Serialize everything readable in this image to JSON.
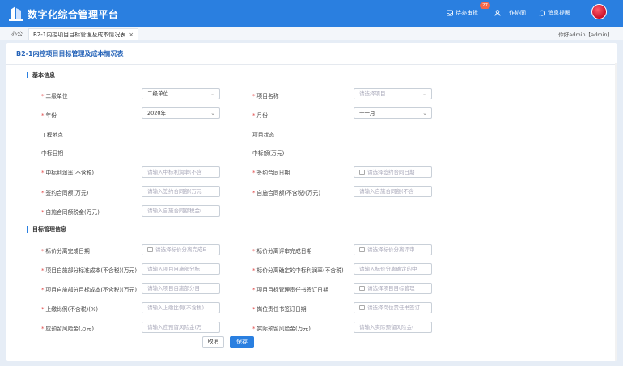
{
  "header": {
    "title": "数字化综合管理平台",
    "nav": [
      {
        "label": "待办审批",
        "icon": "inbox-icon",
        "badge": "27"
      },
      {
        "label": "工作协同",
        "icon": "user-icon"
      },
      {
        "label": "消息提醒",
        "icon": "bell-icon"
      }
    ],
    "accent": "#2a7fe0"
  },
  "tabs": {
    "home": "办公",
    "active": "B2-1内控项目目标管理及成本情况表",
    "close": "×"
  },
  "user": "你好admin【admin】",
  "page": {
    "title": "B2-1内控项目目标管理及成本情况表"
  },
  "sections": {
    "basic": "基本信息",
    "target": "目标管理信息"
  },
  "fields": {
    "unit": {
      "label": "二级单位",
      "value": "二级单位"
    },
    "project": {
      "label": "项目名称",
      "placeholder": "请选择项目"
    },
    "year": {
      "label": "年份",
      "value": "2020年"
    },
    "month": {
      "label": "月份",
      "value": "十一月"
    },
    "location": {
      "label": "工程地点"
    },
    "status": {
      "label": "项目状态"
    },
    "bid_date": {
      "label": "中标日期"
    },
    "bid_amount": {
      "label": "中标额(万元)"
    },
    "bid_profit": {
      "label": "中标利润率(不含税)",
      "placeholder": "请输入中标利润率(不含"
    },
    "sign_date": {
      "label": "签约合同日期",
      "placeholder": "请选择签约合同日期"
    },
    "sign_amount": {
      "label": "签约合同额(万元)",
      "placeholder": "请输入签约合同额(万元"
    },
    "self_amount": {
      "label": "自施合同额(不含税)(万元)",
      "placeholder": "请输入自施合同额(不含"
    },
    "self_tax": {
      "label": "自施合同额税金(万元)",
      "placeholder": "请输入自施合同额税金("
    },
    "split_date": {
      "label": "标价分离完成日期",
      "placeholder": "请选择标价分离完成E"
    },
    "review_date": {
      "label": "标价分离评审完成日期",
      "placeholder": "请选择标价分离评审"
    },
    "self_cost": {
      "label": "项目自施部分标准成本(不含税)(万元)",
      "placeholder": "请输入项目自施部分标"
    },
    "split_profit": {
      "label": "标价分离确定的中标利润率(不含税)",
      "placeholder": "请输入标价分离确定的中"
    },
    "target_cost": {
      "label": "项目自施部分目标成本(不含税)(万元)",
      "placeholder": "请输入项目自施部分目"
    },
    "duty_date": {
      "label": "项目目标管理责任书签订日期",
      "placeholder": "请选择项目目标管理"
    },
    "pay_ratio": {
      "label": "上缴比例(不含税)(%)",
      "placeholder": "请输入上缴比例(不含税)"
    },
    "post_date": {
      "label": "岗位责任书签订日期",
      "placeholder": "请选择岗位责任书签订"
    },
    "risk_due": {
      "label": "应预留风险金(万元)",
      "placeholder": "请输入应预留风险金(万"
    },
    "risk_real": {
      "label": "实际预留风险金(万元)",
      "placeholder": "请输入实际预留风险金("
    }
  },
  "buttons": {
    "cancel": "取消",
    "save": "保存"
  }
}
